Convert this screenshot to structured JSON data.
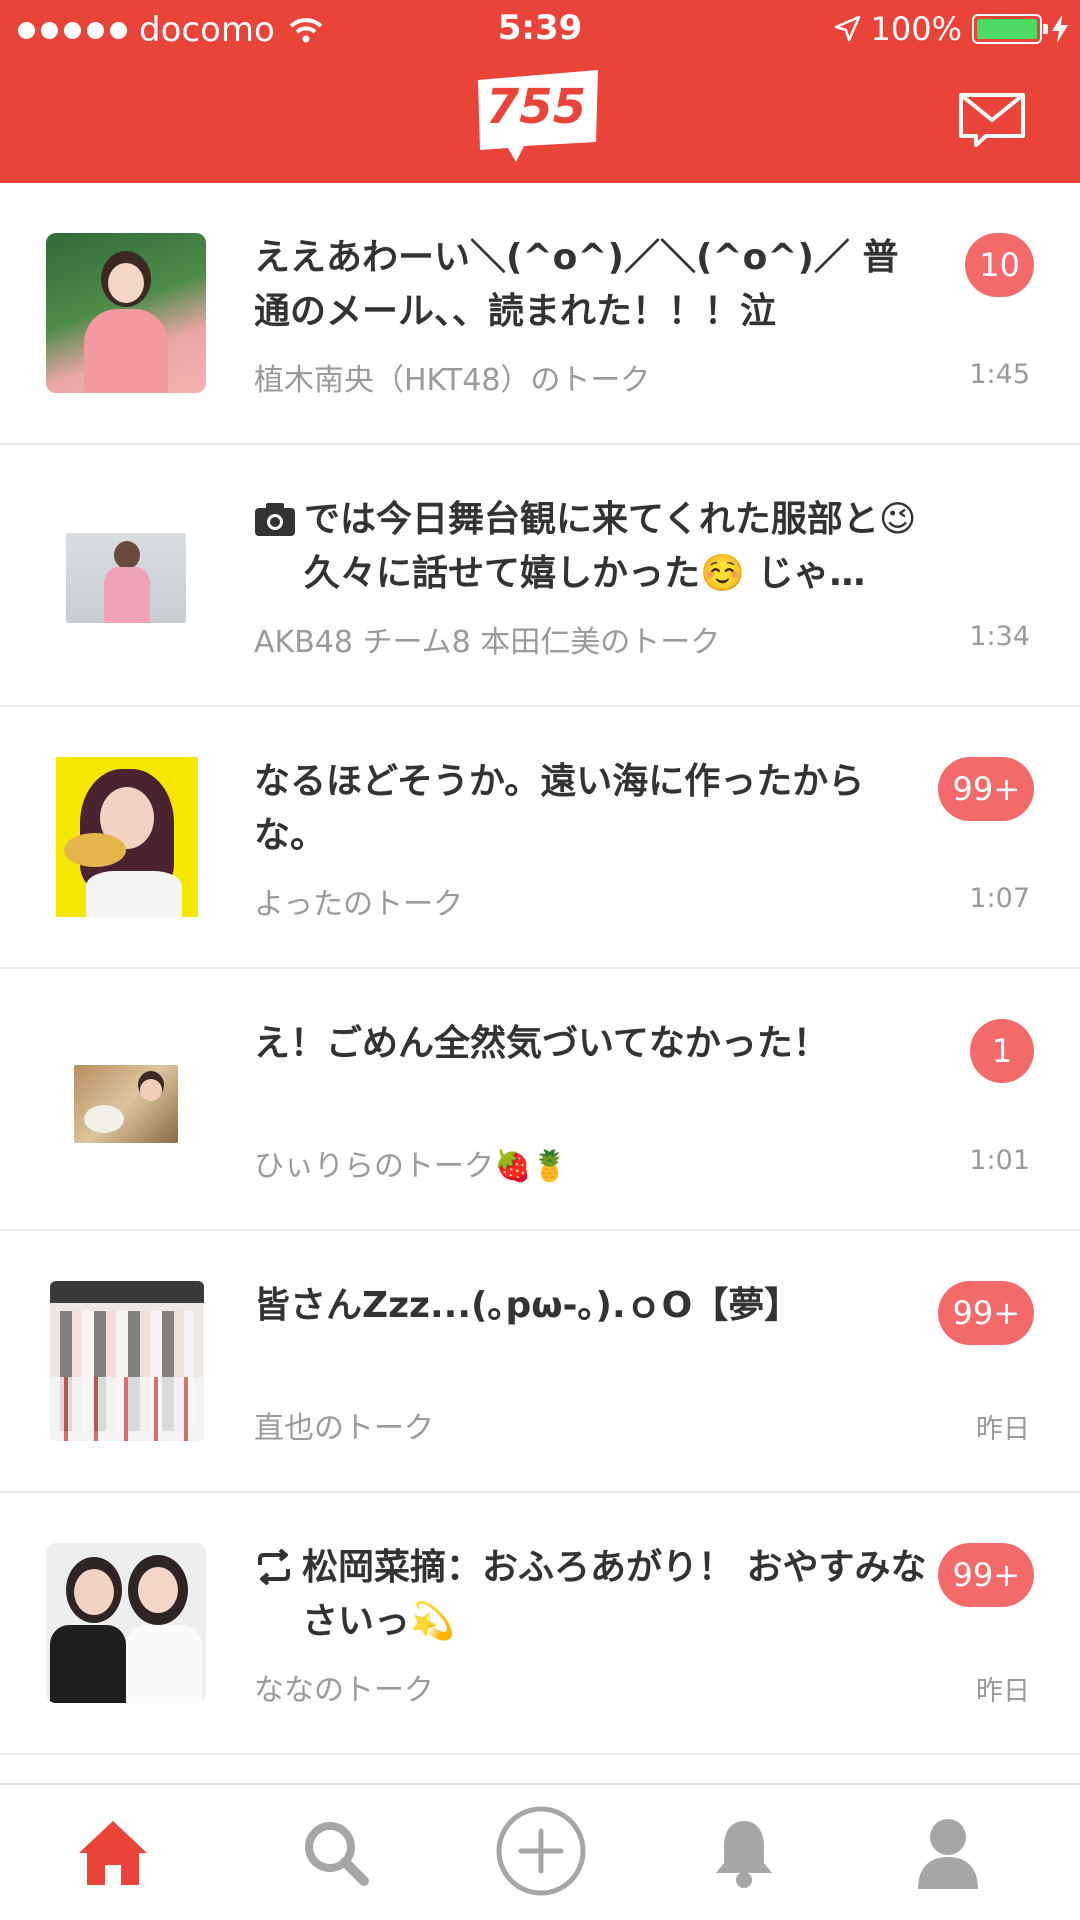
{
  "status_bar": {
    "carrier": "docomo",
    "time": "5:39",
    "battery": "100%",
    "battery_level": 1.0
  },
  "header": {
    "logo_text": "755",
    "message_icon": "mail-icon"
  },
  "colors": {
    "brand_red": "#e8443a",
    "badge_red": "#f26a6a"
  },
  "talks": [
    {
      "title": "ええあわーい＼(^o^)／＼(^o^)／ 普通のメール、、読まれた！！！泣",
      "subtitle": "植木南央（HKT48）のトーク",
      "time": "1:45",
      "badge": "10"
    },
    {
      "title": "では今日舞台観に来てくれた服部と😉 久々に話せて嬉しかった☺️ じゃ…",
      "subtitle": "AKB48 チーム8 本田仁美のトーク",
      "time": "1:34",
      "badge": ""
    },
    {
      "title": "なるほどそうか。遠い海に作ったからな。",
      "subtitle": "よったのトーク",
      "time": "1:07",
      "badge": "99+"
    },
    {
      "title": "え！ごめん全然気づいてなかった！",
      "subtitle": "ひぃりらのトーク🍓🍍",
      "time": "1:01",
      "badge": "1"
    },
    {
      "title": "皆さんZzz...(｡pω-｡).ｏO【夢】",
      "subtitle": "直也のトーク",
      "time": "昨日",
      "badge": "99+"
    },
    {
      "title": "松岡菜摘：おふろあがり！ おやすみなさいっ💫",
      "subtitle": "ななのトーク",
      "time": "昨日",
      "badge": "99+"
    }
  ],
  "tabs": [
    {
      "name": "home",
      "icon": "home-icon",
      "active": true
    },
    {
      "name": "search",
      "icon": "search-icon",
      "active": false
    },
    {
      "name": "post",
      "icon": "plus-circle-icon",
      "active": false
    },
    {
      "name": "notifications",
      "icon": "bell-icon",
      "active": false
    },
    {
      "name": "profile",
      "icon": "person-icon",
      "active": false
    }
  ]
}
